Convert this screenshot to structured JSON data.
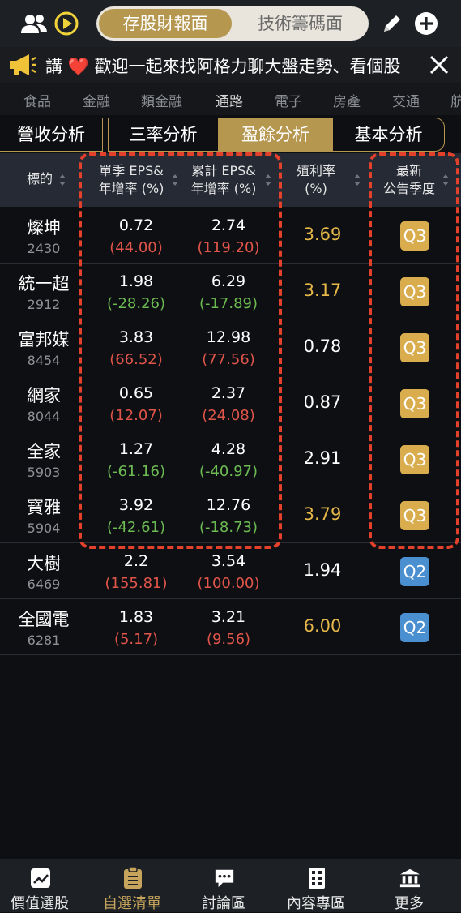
{
  "header": {
    "seg_active": "存股財報面",
    "seg_other": "技術籌碼面"
  },
  "marquee": {
    "text": "講 ❤️ 歡迎一起來找阿格力聊大盤走勢、看個股"
  },
  "categories": [
    "食品",
    "金融",
    "類金融",
    "通路",
    "電子",
    "房產",
    "交通",
    "航"
  ],
  "tabs": [
    "營收分析",
    "三率分析",
    "盈餘分析",
    "基本分析"
  ],
  "table": {
    "headers": {
      "symbol": "標的",
      "eps_q_1": "單季 EPS&",
      "eps_q_2": "年增率 (%)",
      "eps_c_1": "累計 EPS&",
      "eps_c_2": "年增率 (%)",
      "yield_1": "殖利率",
      "yield_2": "(%)",
      "season_1": "最新",
      "season_2": "公告季度"
    },
    "rows": [
      {
        "name": "燦坤",
        "code": "2430",
        "eps_q": "0.72",
        "eps_q_pct": "(44.00)",
        "eps_c": "2.74",
        "eps_c_pct": "(119.20)",
        "yield": "3.69",
        "season": "Q3"
      },
      {
        "name": "統一超",
        "code": "2912",
        "eps_q": "1.98",
        "eps_q_pct": "(-28.26)",
        "eps_c": "6.29",
        "eps_c_pct": "(-17.89)",
        "yield": "3.17",
        "season": "Q3"
      },
      {
        "name": "富邦媒",
        "code": "8454",
        "eps_q": "3.83",
        "eps_q_pct": "(66.52)",
        "eps_c": "12.98",
        "eps_c_pct": "(77.56)",
        "yield": "0.78",
        "season": "Q3"
      },
      {
        "name": "網家",
        "code": "8044",
        "eps_q": "0.65",
        "eps_q_pct": "(12.07)",
        "eps_c": "2.37",
        "eps_c_pct": "(24.08)",
        "yield": "0.87",
        "season": "Q3"
      },
      {
        "name": "全家",
        "code": "5903",
        "eps_q": "1.27",
        "eps_q_pct": "(-61.16)",
        "eps_c": "4.28",
        "eps_c_pct": "(-40.97)",
        "yield": "2.91",
        "season": "Q3"
      },
      {
        "name": "寶雅",
        "code": "5904",
        "eps_q": "3.92",
        "eps_q_pct": "(-42.61)",
        "eps_c": "12.76",
        "eps_c_pct": "(-18.73)",
        "yield": "3.79",
        "season": "Q3"
      },
      {
        "name": "大樹",
        "code": "6469",
        "eps_q": "2.2",
        "eps_q_pct": "(155.81)",
        "eps_c": "3.54",
        "eps_c_pct": "(100.00)",
        "yield": "1.94",
        "season": "Q2"
      },
      {
        "name": "全國電",
        "code": "6281",
        "eps_q": "1.83",
        "eps_q_pct": "(5.17)",
        "eps_c": "3.21",
        "eps_c_pct": "(9.56)",
        "yield": "6.00",
        "season": "Q2"
      }
    ]
  },
  "bottom_nav": [
    "價值選股",
    "自選清單",
    "討論區",
    "內容專區",
    "更多"
  ],
  "colors": {
    "gold": "#b59750",
    "red": "#e0554a",
    "green": "#6cbb52",
    "yield_gold": "#e6b84a",
    "q3_badge": "#d9ad4e",
    "q2_badge": "#4a8fcf",
    "dash": "#e3412b"
  }
}
